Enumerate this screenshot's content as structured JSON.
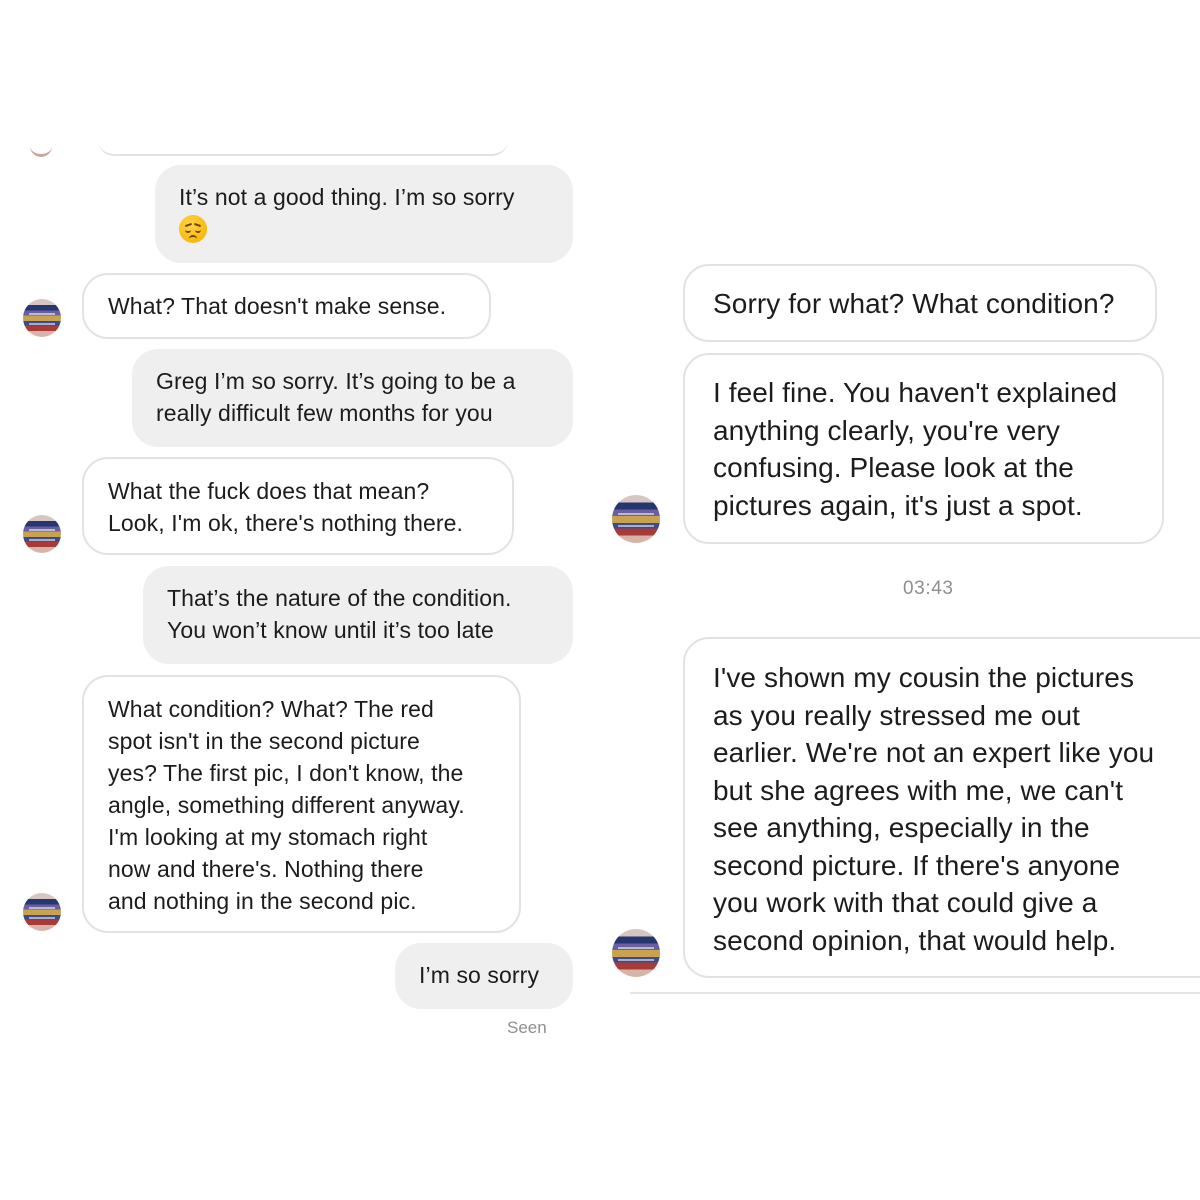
{
  "left_panel": {
    "messages": [
      {
        "direction": "outgoing",
        "text": "It’s not a good thing. I’m so sorry",
        "emoji": "disappointed-face"
      },
      {
        "direction": "incoming",
        "text": "What? That doesn't make sense."
      },
      {
        "direction": "outgoing",
        "lines": [
          "Greg I’m so sorry. It’s going to be a",
          "really difficult few months for you"
        ]
      },
      {
        "direction": "incoming",
        "lines": [
          "What the fuck does that mean?",
          "Look, I'm ok, there's nothing there."
        ]
      },
      {
        "direction": "outgoing",
        "lines": [
          "That’s the nature of the condition.",
          "You won’t know until it’s too late"
        ]
      },
      {
        "direction": "incoming",
        "lines": [
          "What condition? What? The red",
          "spot isn't in the second picture",
          "yes? The first pic, I don't know, the",
          "angle, something different anyway.",
          "I'm looking at my stomach right",
          "now and there's. Nothing there",
          "and nothing in the second pic."
        ]
      },
      {
        "direction": "outgoing",
        "text": "I’m so sorry"
      }
    ],
    "status": "Seen"
  },
  "right_panel": {
    "messages": [
      {
        "direction": "incoming",
        "text": "Sorry for what? What condition?"
      },
      {
        "direction": "incoming",
        "lines": [
          "I feel fine. You haven't explained",
          "anything clearly, you're very",
          "confusing. Please look at the",
          "pictures again, it's just a spot."
        ]
      },
      {
        "direction": "incoming",
        "lines": [
          "I've shown my cousin the pictures",
          "as you really stressed me out",
          "earlier. We're not an expert like you",
          "but she agrees with me, we can't",
          "see anything, especially in the",
          "second picture. If there's anyone",
          "you work with that could give a",
          "second opinion, that would help."
        ]
      }
    ],
    "timestamp": "03:43"
  },
  "colors": {
    "outgoing_bubble": "#efefef",
    "incoming_border": "#e2e2e2",
    "meta_text": "#8e8e8e"
  },
  "icons": {
    "avatar": "contact-avatar",
    "emoji": "disappointed-face-emoji"
  }
}
